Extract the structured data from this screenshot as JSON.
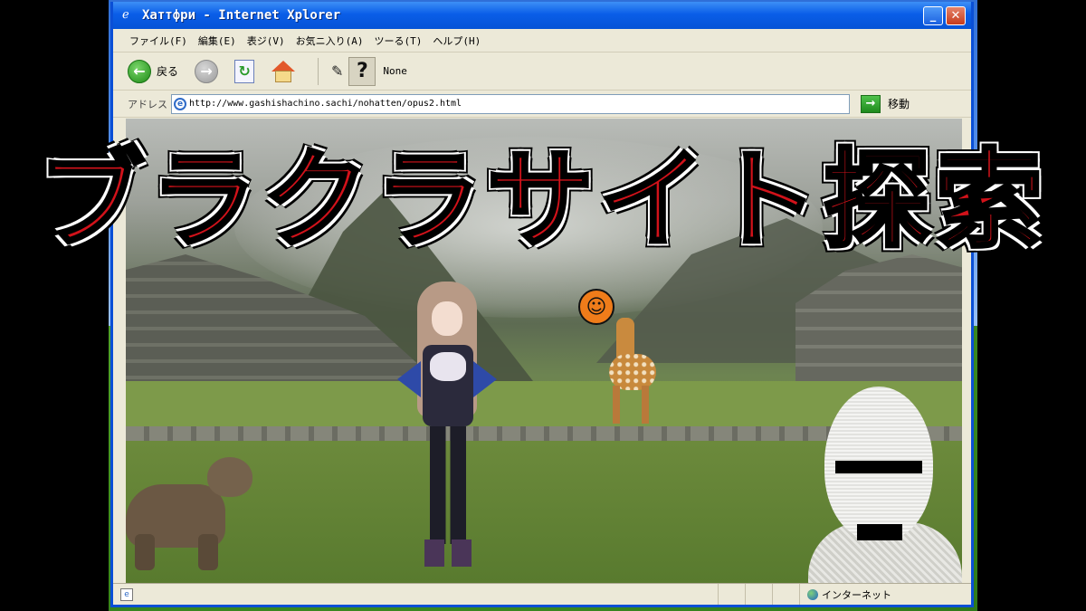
{
  "window": {
    "title": "Хаттфри - Internet Xplorer",
    "minimize_glyph": "_",
    "close_glyph": "✕"
  },
  "menu": {
    "items": [
      {
        "label": "ファイル(F)"
      },
      {
        "label": "編集(E)"
      },
      {
        "label": "表ジ(V)"
      },
      {
        "label": "お気ニ入り(A)"
      },
      {
        "label": "ツーる(T)"
      },
      {
        "label": "ヘルプ(H)"
      }
    ]
  },
  "toolbar": {
    "back_label": "戻る",
    "none_label": "None"
  },
  "address": {
    "label": "アドレス",
    "url": "http://www.gashishachino.sachi/nohatten/opus2.html",
    "go_label": "移動"
  },
  "overlay": {
    "title": "ブラクラサイト探索"
  },
  "status": {
    "zone_label": "インターネット"
  },
  "colors": {
    "titlebar": "#0a5ee8",
    "overlay_text": "#d2121a"
  }
}
